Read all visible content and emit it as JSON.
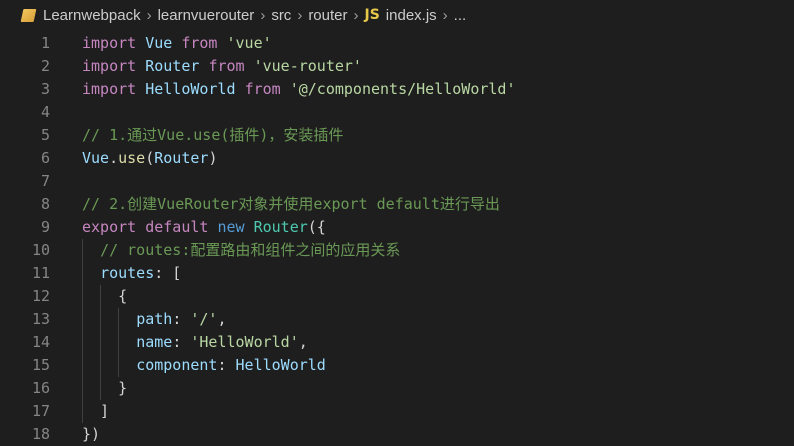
{
  "breadcrumb": {
    "items": [
      "Learnwebpack",
      "learnvuerouter",
      "src",
      "router"
    ],
    "file_badge": "JS",
    "file_name": "index.js",
    "trailing": "..."
  },
  "colors": {
    "background": "#1e1e1e",
    "keyword": "#569cd6",
    "string": "#6a9955",
    "comment": "#6a9955",
    "property": "#9cdcfe",
    "line_number": "#858585"
  },
  "lines": [
    {
      "n": "1",
      "tokens": [
        [
          "kw2",
          "import"
        ],
        [
          "pun",
          " "
        ],
        [
          "prop",
          "Vue"
        ],
        [
          "pun",
          " "
        ],
        [
          "kw2",
          "from"
        ],
        [
          "pun",
          " "
        ],
        [
          "s-lime",
          "'vue'"
        ]
      ]
    },
    {
      "n": "2",
      "tokens": [
        [
          "kw2",
          "import"
        ],
        [
          "pun",
          " "
        ],
        [
          "prop",
          "Router"
        ],
        [
          "pun",
          " "
        ],
        [
          "kw2",
          "from"
        ],
        [
          "pun",
          " "
        ],
        [
          "s-lime",
          "'vue-router'"
        ]
      ]
    },
    {
      "n": "3",
      "tokens": [
        [
          "kw2",
          "import"
        ],
        [
          "pun",
          " "
        ],
        [
          "prop",
          "HelloWorld"
        ],
        [
          "pun",
          " "
        ],
        [
          "kw2",
          "from"
        ],
        [
          "pun",
          " "
        ],
        [
          "s-lime",
          "'@/components/HelloWorld'"
        ]
      ]
    },
    {
      "n": "4",
      "tokens": []
    },
    {
      "n": "5",
      "tokens": [
        [
          "cm",
          "// 1.通过Vue.use(插件)，安装插件"
        ]
      ]
    },
    {
      "n": "6",
      "tokens": [
        [
          "prop",
          "Vue"
        ],
        [
          "pun",
          "."
        ],
        [
          "fn",
          "use"
        ],
        [
          "pun",
          "("
        ],
        [
          "prop",
          "Router"
        ],
        [
          "pun",
          ")"
        ]
      ]
    },
    {
      "n": "7",
      "tokens": []
    },
    {
      "n": "8",
      "tokens": [
        [
          "cm",
          "// 2.创建VueRouter对象并使用export default进行导出"
        ]
      ]
    },
    {
      "n": "9",
      "tokens": [
        [
          "kw2",
          "export"
        ],
        [
          "pun",
          " "
        ],
        [
          "kw2",
          "default"
        ],
        [
          "pun",
          " "
        ],
        [
          "kw",
          "new"
        ],
        [
          "pun",
          " "
        ],
        [
          "cls",
          "Router"
        ],
        [
          "pun",
          "({"
        ]
      ]
    },
    {
      "n": "10",
      "tokens": [
        [
          "pun",
          "  "
        ],
        [
          "cm",
          "// routes:配置路由和组件之间的应用关系"
        ]
      ]
    },
    {
      "n": "11",
      "tokens": [
        [
          "pun",
          "  "
        ],
        [
          "prop",
          "routes"
        ],
        [
          "pun",
          ": ["
        ]
      ]
    },
    {
      "n": "12",
      "tokens": [
        [
          "pun",
          "    {"
        ]
      ]
    },
    {
      "n": "13",
      "tokens": [
        [
          "pun",
          "      "
        ],
        [
          "prop",
          "path"
        ],
        [
          "pun",
          ": "
        ],
        [
          "s-lime",
          "'/'"
        ],
        [
          "pun",
          ","
        ]
      ]
    },
    {
      "n": "14",
      "tokens": [
        [
          "pun",
          "      "
        ],
        [
          "prop",
          "name"
        ],
        [
          "pun",
          ": "
        ],
        [
          "s-lime",
          "'HelloWorld'"
        ],
        [
          "pun",
          ","
        ]
      ]
    },
    {
      "n": "15",
      "tokens": [
        [
          "pun",
          "      "
        ],
        [
          "prop",
          "component"
        ],
        [
          "pun",
          ": "
        ],
        [
          "prop",
          "HelloWorld"
        ]
      ]
    },
    {
      "n": "16",
      "tokens": [
        [
          "pun",
          "    }"
        ]
      ]
    },
    {
      "n": "17",
      "tokens": [
        [
          "pun",
          "  ]"
        ]
      ]
    },
    {
      "n": "18",
      "tokens": [
        [
          "pun",
          "})"
        ]
      ]
    }
  ]
}
